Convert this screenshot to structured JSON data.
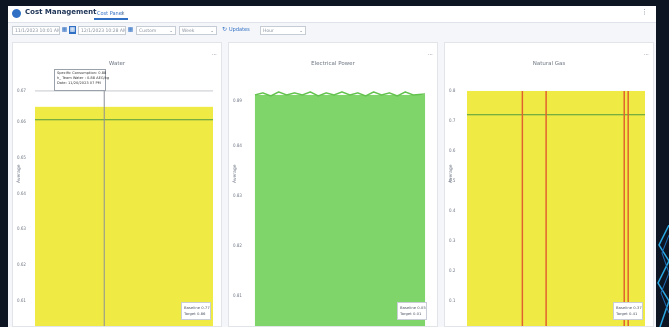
{
  "header": {
    "title": "Cost Management",
    "tab_label": "Cost Panel",
    "tab_close": "×",
    "more": "⋮"
  },
  "toolbar": {
    "start_date": "11/1/2023 10:01 AM",
    "end_date": "12/1/2023 10:28 AM",
    "range": "Custom",
    "period": "Week",
    "updates_label": "Updates",
    "interval": "Hour"
  },
  "panels": [
    {
      "title": "Water",
      "ylabel": "Average",
      "menu": "⋯",
      "ticks": [
        "0.67",
        "0.66",
        "0.65",
        "0.64",
        "0.63",
        "0.62",
        "0.61"
      ],
      "legend": [
        "Baseline 0.77",
        "Target 0.86"
      ],
      "tooltip": [
        "Specific Consumption: 0.88",
        "h_ Team Water : 0.88 AEG/kg",
        "Date: 11/20/2023 07 PM"
      ],
      "bar_color": "#f0ea45"
    },
    {
      "title": "Electrical Power",
      "ylabel": "Average",
      "menu": "⋯",
      "ticks": [
        "0.89",
        "0.84",
        "0.83",
        "0.82",
        "0.81"
      ],
      "legend": [
        "Baseline 0.05",
        "Target 0.01"
      ],
      "bar_color": "#7fd56a"
    },
    {
      "title": "Natural Gas",
      "ylabel": "Average",
      "menu": "⋯",
      "ticks": [
        "0.8",
        "0.7",
        "0.6",
        "0.5",
        "0.4",
        "0.3",
        "0.2",
        "0.1"
      ],
      "legend": [
        "Baseline 0.37",
        "Target 0.41"
      ],
      "bar_color": "#f0ea45"
    }
  ]
}
